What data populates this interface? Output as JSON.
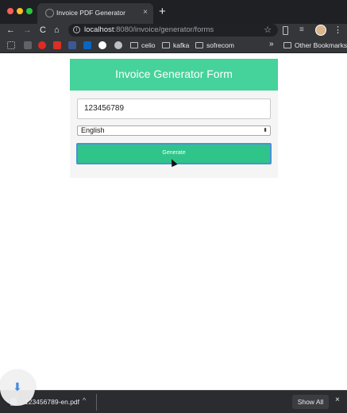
{
  "browser": {
    "tab_title": "Invoice PDF Generator",
    "tab_close": "×",
    "new_tab": "+",
    "nav": {
      "back": "←",
      "forward": "→",
      "reload": "C",
      "home": "⌂"
    },
    "url_host": "localhost",
    "url_path": ":8080/invoice/generator/forms",
    "star": "☆",
    "info": "i",
    "menu": "⋮",
    "bookmarks": [
      {
        "label": "",
        "color": "#ffffff"
      },
      {
        "label": "",
        "color": "#e02b20"
      },
      {
        "label": "",
        "color": "#d93025"
      },
      {
        "label": "",
        "color": "#3b5998"
      },
      {
        "label": "",
        "color": "#0a66c2"
      },
      {
        "label": "",
        "color": "#ffffff"
      },
      {
        "label": "",
        "color": "#bdc1c6"
      }
    ],
    "bookmark_folders": [
      "celio",
      "kafka",
      "sofrecom"
    ],
    "bookmarks_more": "»",
    "other_bookmarks": "Other Bookmarks"
  },
  "form": {
    "title": "Invoice Generator Form",
    "invoice_number": "123456789",
    "language": "English",
    "generate_label": "Generate"
  },
  "downloads": {
    "file_name": "123456789-en.pdf",
    "show_all": "Show All",
    "close": "×",
    "chevron": "^",
    "arrow": "⬇"
  }
}
